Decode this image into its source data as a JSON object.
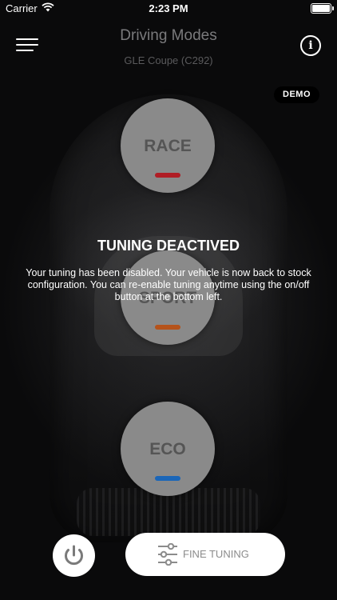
{
  "status_bar": {
    "carrier": "Carrier",
    "time": "2:23 PM"
  },
  "header": {
    "title": "Driving Modes",
    "subtitle": "GLE Coupe (C292)",
    "menu_icon": "hamburger-icon",
    "info_icon": "info-icon"
  },
  "badge": {
    "label": "DEMO"
  },
  "modes": [
    {
      "label": "RACE",
      "indicator_color": "#b01d25"
    },
    {
      "label": "SPORT",
      "indicator_color": "#b5531b"
    },
    {
      "label": "ECO",
      "indicator_color": "#1b66b8"
    }
  ],
  "overlay": {
    "title": "TUNING DEACTIVED",
    "message": "Your tuning has been disabled. Your vehicle is now back to stock configuration. You can re-enable tuning anytime using the on/off button at the bottom left."
  },
  "bottom": {
    "power_icon": "power-icon",
    "fine_tuning_label": "FINE TUNING",
    "fine_tuning_icon": "sliders-icon"
  }
}
